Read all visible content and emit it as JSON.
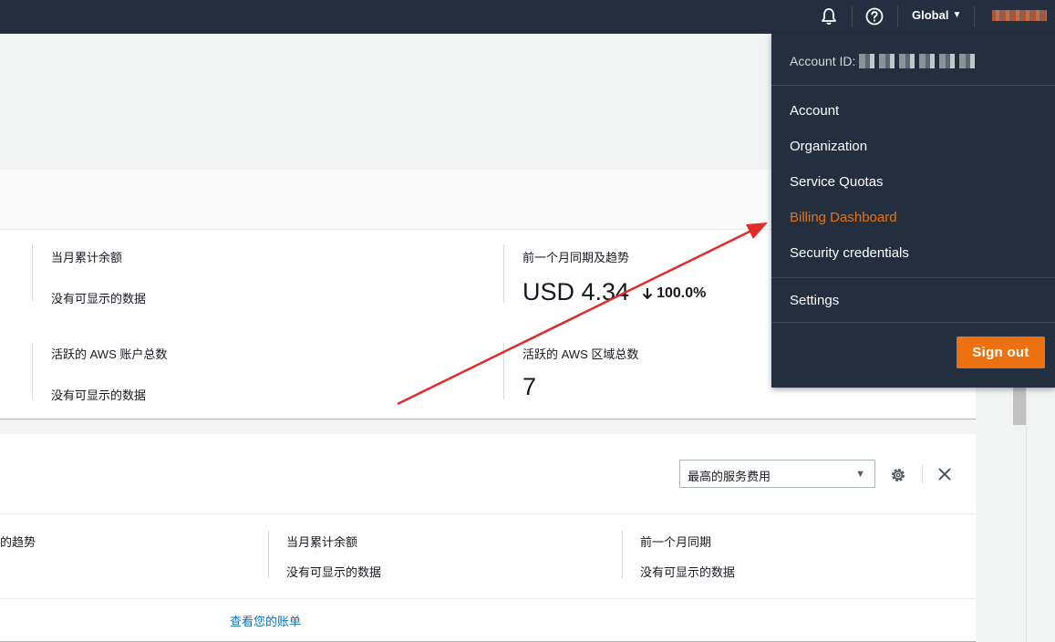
{
  "nav": {
    "region": "Global"
  },
  "menu": {
    "account_id_label": "Account ID:",
    "items": [
      "Account",
      "Organization",
      "Service Quotas",
      "Billing Dashboard",
      "Security credentials"
    ],
    "settings": "Settings",
    "signout": "Sign out"
  },
  "card1": {
    "m1_label": "当月累计余额",
    "m1_value": "没有可显示的数据",
    "m2_label": "前一个月同期及趋势",
    "m2_value": "USD 4.34",
    "m2_trend": "100.0%",
    "m3_label": "活跃的 AWS 账户总数",
    "m3_value": "没有可显示的数据",
    "m4_label": "活跃的 AWS 区域总数",
    "m4_value": "7"
  },
  "card2": {
    "select_value": "最高的服务费用",
    "col1_label": "的趋势",
    "col2_label": "当月累计余额",
    "col2_value": "没有可显示的数据",
    "col3_label": "前一个月同期",
    "col3_value": "没有可显示的数据",
    "link": "查看您的账单"
  },
  "colors": {
    "nav_bg": "#232f3e",
    "accent": "#ec7211",
    "link": "#0073bb",
    "annotation_arrow": "#e02b2b"
  }
}
